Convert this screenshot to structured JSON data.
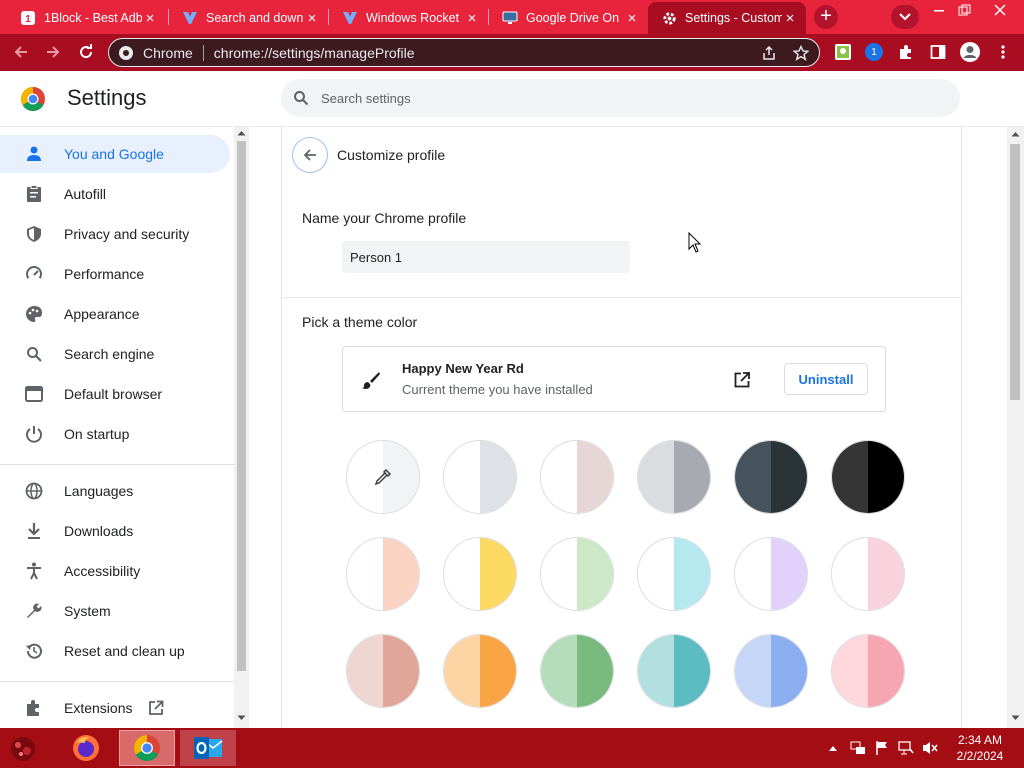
{
  "tabs": [
    {
      "title": "1Block - Best Adb",
      "icon": "1block-icon"
    },
    {
      "title": "Search and down",
      "icon": "ytx-icon"
    },
    {
      "title": "Windows Rocket",
      "icon": "ytx-icon"
    },
    {
      "title": "Google Drive On",
      "icon": "monitor-icon"
    },
    {
      "title": "Settings - Custom",
      "icon": "gear-icon"
    }
  ],
  "toolbar": {
    "omnibox_site": "Chrome",
    "omnibox_url": "chrome://settings/manageProfile",
    "extension_badge": "1"
  },
  "settings": {
    "title": "Settings",
    "search_placeholder": "Search settings"
  },
  "sidebar": {
    "items": [
      {
        "label": "You and Google",
        "icon": "person-icon"
      },
      {
        "label": "Autofill",
        "icon": "clipboard-icon"
      },
      {
        "label": "Privacy and security",
        "icon": "shield-icon"
      },
      {
        "label": "Performance",
        "icon": "speedometer-icon"
      },
      {
        "label": "Appearance",
        "icon": "palette-icon"
      },
      {
        "label": "Search engine",
        "icon": "search-icon"
      },
      {
        "label": "Default browser",
        "icon": "browser-icon"
      },
      {
        "label": "On startup",
        "icon": "power-icon"
      },
      {
        "label": "Languages",
        "icon": "globe-icon"
      },
      {
        "label": "Downloads",
        "icon": "download-icon"
      },
      {
        "label": "Accessibility",
        "icon": "accessibility-icon"
      },
      {
        "label": "System",
        "icon": "wrench-icon"
      },
      {
        "label": "Reset and clean up",
        "icon": "restore-icon"
      },
      {
        "label": "Extensions",
        "icon": "puzzle-icon"
      }
    ]
  },
  "customize": {
    "heading": "Customize profile",
    "name_label": "Name your Chrome profile",
    "name_value": "Person 1",
    "theme_label": "Pick a theme color",
    "theme_name": "Happy New Year Rd",
    "theme_desc": "Current theme you have installed",
    "uninstall_label": "Uninstall"
  },
  "swatches": [
    [
      "#ffffff",
      "#f1f3f4"
    ],
    [
      "#ffffff",
      "#dee1e6"
    ],
    [
      "#ffffff",
      "#e6d6d4"
    ],
    [
      "#dadce0",
      "#a8aab2"
    ],
    [
      "#46535d",
      "#2a3338"
    ],
    [
      "#353535",
      "#000000"
    ],
    [
      "#ffffff",
      "#fbd3c2"
    ],
    [
      "#ffffff",
      "#fcd961"
    ],
    [
      "#ffffff",
      "#cce8c6"
    ],
    [
      "#ffffff",
      "#b5e8ef"
    ],
    [
      "#ffffff",
      "#e2d2fb"
    ],
    [
      "#ffffff",
      "#f8d3de"
    ],
    [
      "#efd6d0",
      "#e1a69a"
    ],
    [
      "#fdd5a4",
      "#f9a545"
    ],
    [
      "#b6ddb9",
      "#79bb7e"
    ],
    [
      "#b2e0e1",
      "#5bbdc1"
    ],
    [
      "#c5d6f6",
      "#8aaef0"
    ],
    [
      "#fdd7dc",
      "#f6a6b0"
    ]
  ],
  "taskbar": {
    "time": "2:34 AM",
    "date": "2/2/2024"
  },
  "colors": {
    "tab_bar": "#e8243d",
    "toolbar": "#a90d22",
    "accent": "#1a73e8",
    "taskbar": "#a40d14"
  }
}
